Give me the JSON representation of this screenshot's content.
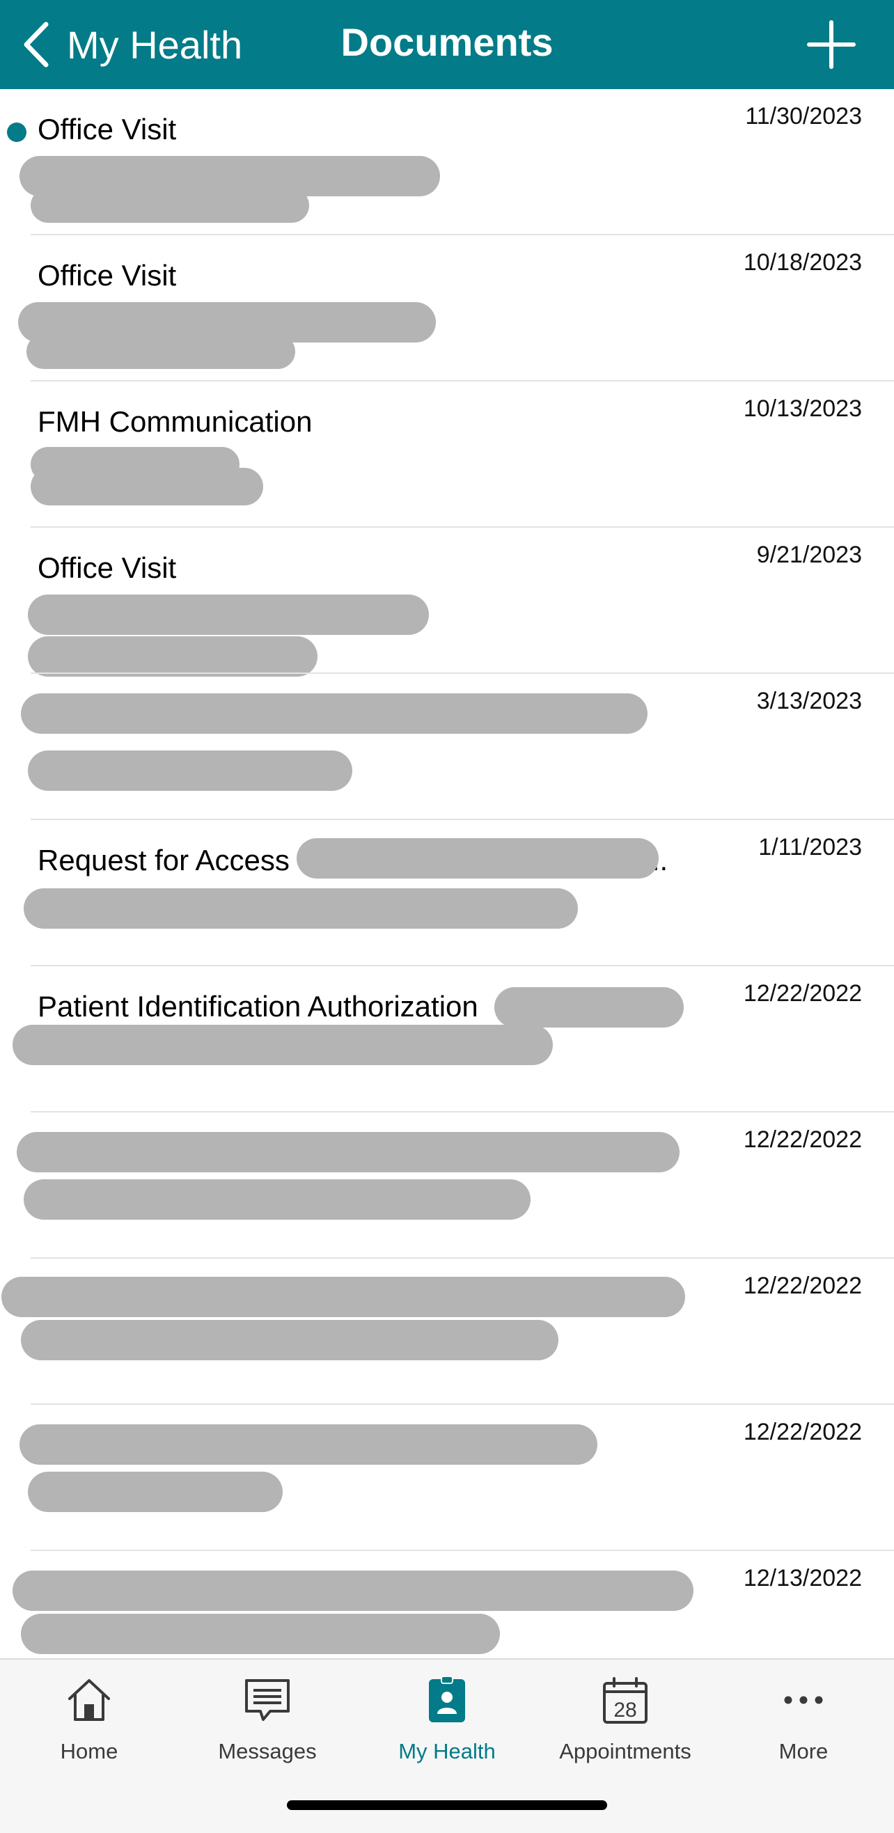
{
  "header": {
    "back_label": "My Health",
    "title": "Documents",
    "background": "#037b88"
  },
  "documents": [
    {
      "title": "Office Visit",
      "date": "11/30/2023",
      "unread": true
    },
    {
      "title": "Office Visit",
      "date": "10/18/2023",
      "unread": false
    },
    {
      "title": "FMH Communication",
      "date": "10/13/2023",
      "unread": false
    },
    {
      "title": "Office Visit",
      "date": "9/21/2023",
      "unread": false
    },
    {
      "title": "",
      "date": "3/13/2023",
      "unread": false
    },
    {
      "title": "Request for Access",
      "title_suffix": "..",
      "date": "1/11/2023",
      "unread": false
    },
    {
      "title": "Patient Identification Authorization",
      "date": "12/22/2022",
      "unread": false
    },
    {
      "title": "",
      "date": "12/22/2022",
      "unread": false
    },
    {
      "title": "",
      "date": "12/22/2022",
      "unread": false
    },
    {
      "title": "",
      "date": "12/22/2022",
      "unread": false
    },
    {
      "title": "",
      "date": "12/13/2022",
      "unread": false
    }
  ],
  "tabs": [
    {
      "label": "Home",
      "icon": "house-icon",
      "active": false
    },
    {
      "label": "Messages",
      "icon": "message-bubble-icon",
      "active": false
    },
    {
      "label": "My Health",
      "icon": "health-record-icon",
      "active": true
    },
    {
      "label": "Appointments",
      "icon": "calendar-icon",
      "active": false,
      "calendar_day": "28"
    },
    {
      "label": "More",
      "icon": "more-dots-icon",
      "active": false
    }
  ],
  "colors": {
    "accent": "#037b88",
    "redaction": "#b4b4b4"
  }
}
